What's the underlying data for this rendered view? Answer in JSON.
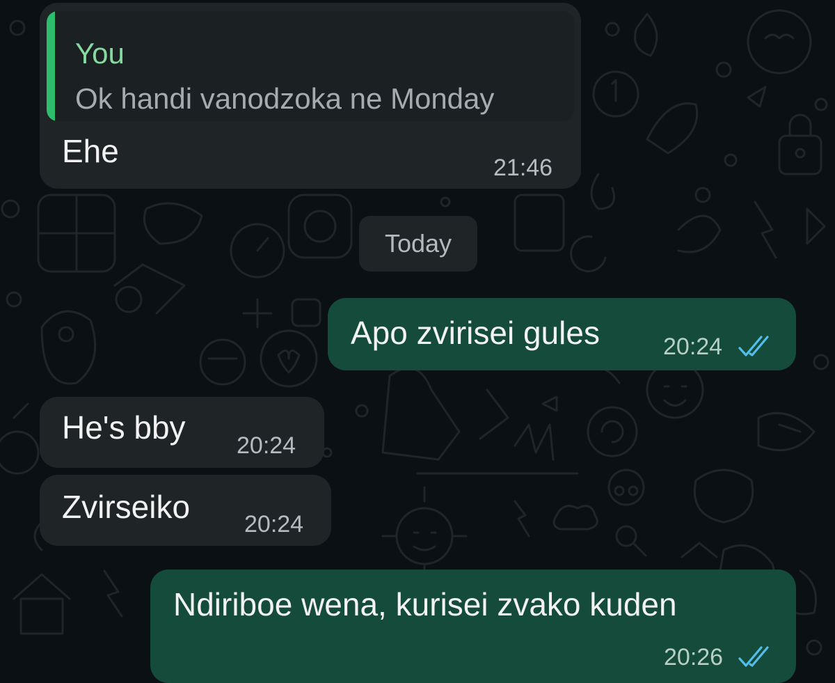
{
  "colors": {
    "incoming_bubble": "#1f2427",
    "outgoing_bubble": "#154b3a",
    "quote_accent": "#2dbd6c",
    "read_ticks": "#53bdeb"
  },
  "messages": [
    {
      "direction": "incoming",
      "reply_to": {
        "author": "You",
        "text": "Ok handi vanodzoka ne Monday"
      },
      "text": "Ehe",
      "time": "21:46"
    },
    {
      "direction": "outgoing",
      "text": "Apo zvirisei gules",
      "time": "20:24",
      "status_icon": "double-check-icon"
    },
    {
      "direction": "incoming",
      "text": "He's bby",
      "time": "20:24"
    },
    {
      "direction": "incoming",
      "text": "Zvirseiko",
      "time": "20:24"
    },
    {
      "direction": "outgoing",
      "text": "Ndiriboe wena, kurisei zvako kuden",
      "time": "20:26",
      "status_icon": "double-check-icon"
    }
  ],
  "date_separator": "Today"
}
